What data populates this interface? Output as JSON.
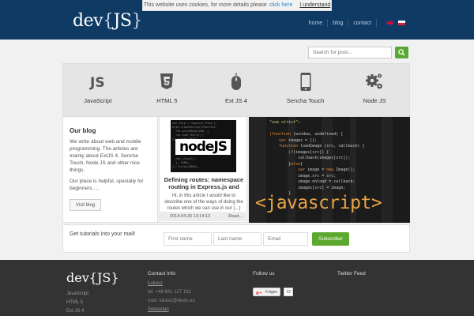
{
  "cookie": {
    "text": "This website uses cookies, for more details please",
    "link": "click here",
    "accept": "I understand"
  },
  "header": {
    "logo_main": "dev",
    "logo_open": "{",
    "logo_mid": "JS",
    "logo_close": "}",
    "nav": [
      "home",
      "blog",
      "contact"
    ],
    "languages": [
      "en-flag-icon",
      "pl-flag-icon"
    ]
  },
  "search": {
    "placeholder": "Search for post...",
    "icon": "search-icon"
  },
  "technologies": [
    {
      "label": "JavaScript",
      "icon": "javascript-icon"
    },
    {
      "label": "HTML 5",
      "icon": "html5-icon"
    },
    {
      "label": "Ext JS 4",
      "icon": "mouse-icon"
    },
    {
      "label": "Sencha Touch",
      "icon": "phone-icon"
    },
    {
      "label": "Node JS",
      "icon": "gears-icon"
    }
  ],
  "blog": {
    "title": "Our blog",
    "para1": "We write about web and mobile programming. The articles are mainly about ExtJS 4, Sencha Touch, Node JS and other nice things.",
    "para2": "Our place is helpful, specially for beginners.....",
    "button": "Visit blog"
  },
  "article": {
    "title": "Defining routes: namespace routing in Express.js and",
    "excerpt": "Hi, in this article I would like to describe one of the ways of doing the routes which we can use in our (...)",
    "date": "2014-04-26 13:14:13",
    "more": "Read..."
  },
  "feature": {
    "label": "<javascript>"
  },
  "newsletter": {
    "label": "Get tutorials into your mail!",
    "first_placeholder": "First name",
    "last_placeholder": "Last name",
    "email_placeholder": "Email",
    "button": "Subscribe!"
  },
  "footer": {
    "logo_main": "dev",
    "logo_open": "{",
    "logo_mid": "JS",
    "logo_close": "}",
    "links": [
      "JavaScript",
      "HTML 5",
      "Ext JS 4"
    ],
    "contact_title": "Contact Info",
    "contact_name1": "Łukasz",
    "contact_tel": "tel. +48 661 127 192",
    "contact_mail": "mail: lukasz@devjs.eu",
    "contact_name2": "Sebastian",
    "follow_title": "Follow us",
    "follow_button": "Folgen",
    "follow_count": "22",
    "twitter_title": "Twitter Feed"
  },
  "colors": {
    "header_bg": "#0e3a63",
    "accent_green": "#5da82e",
    "footer_bg": "#333333",
    "code_orange": "#e8a345"
  }
}
